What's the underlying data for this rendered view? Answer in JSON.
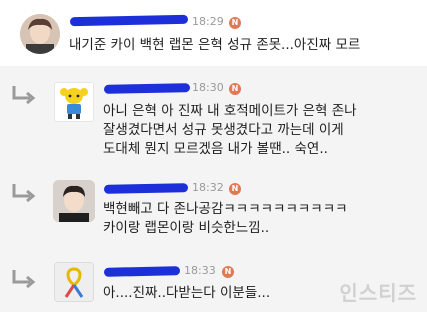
{
  "comments": [
    {
      "is_reply": false,
      "author": "",
      "time": "18:29",
      "badge": "N",
      "avatar_icon": "person-photo-avatar",
      "lines": [
        "내기준 카이 백현 랩몬 은혁 성규 존못...아진짜 모르"
      ]
    },
    {
      "is_reply": true,
      "author": "",
      "time": "18:30",
      "badge": "N",
      "avatar_icon": "cartoon-character-avatar",
      "lines": [
        "아니 은혁 아 진짜 내 호적메이트가 은혁 존나",
        "잘생겼다면서 성규 못생겼다고 까는데 이게",
        "도대체 뭔지 모르겠음 내가 볼땐.. 숙연.."
      ]
    },
    {
      "is_reply": true,
      "author": "",
      "time": "18:32",
      "badge": "N",
      "avatar_icon": "person-photo-avatar",
      "lines": [
        "백현빼고 다 존나공감ㅋㅋㅋㅋㅋㅋㅋㅋㅋㅋ",
        "카이랑 랩몬이랑 비슷한느낌.."
      ]
    },
    {
      "is_reply": true,
      "author": "",
      "time": "18:33",
      "badge": "N",
      "avatar_icon": "ribbon-avatar",
      "lines": [
        "아....진짜..다받는다 이분들..."
      ]
    }
  ],
  "watermark": "인스티즈",
  "colors": {
    "redaction": "#1d2fd8",
    "badge": "#e07a55",
    "time": "#9a9a9a"
  }
}
